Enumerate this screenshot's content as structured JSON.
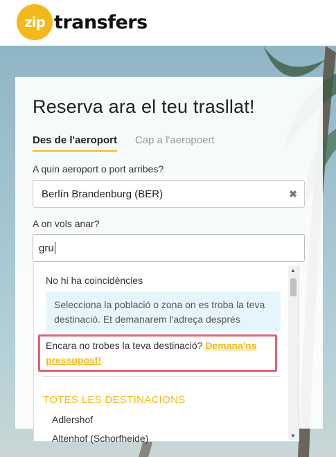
{
  "logo": {
    "zip": "zip",
    "text": "transfers"
  },
  "booking": {
    "title": "Reserva ara el teu trasllat!",
    "tabs": [
      {
        "label": "Des de l'aeroport",
        "active": true
      },
      {
        "label": "Cap a l'aeropoert",
        "active": false
      }
    ],
    "from_label": "A quin aeroport o port arribes?",
    "from_value": "Berlín Brandenburg (BER)",
    "to_label": "A on vols anar?",
    "to_value": "gru"
  },
  "dropdown": {
    "no_match": "No hi ha coincidències",
    "info": "Selecciona la població o zona on es troba la teva destinació. Et demanarem l'adreça després",
    "still_text": "Encara no trobes la teva destinació?",
    "quote_link": "Demana'ns pressupost!",
    "section_heading": "TOTES LES DESTINACIONS",
    "destinations": [
      "Adlershof",
      "Altenhof (Schorfheide)"
    ]
  },
  "colors": {
    "accent": "#f4b81a",
    "highlight_border": "#e06474",
    "info_bg": "#e6f5fb"
  }
}
